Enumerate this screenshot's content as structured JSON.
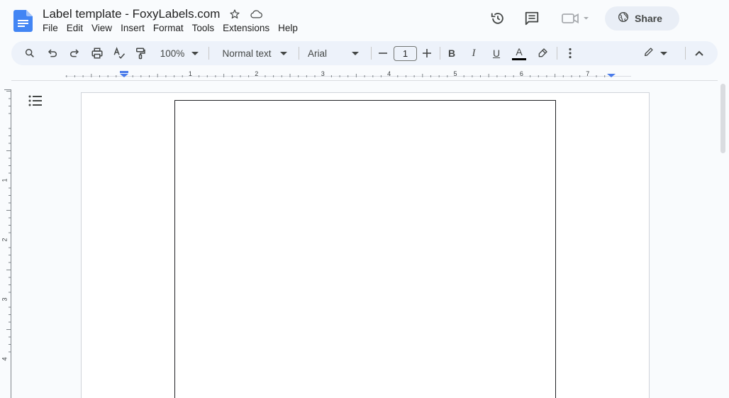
{
  "document": {
    "title": "Label template - FoxyLabels.com"
  },
  "menu": [
    "File",
    "Edit",
    "View",
    "Insert",
    "Format",
    "Tools",
    "Extensions",
    "Help"
  ],
  "header": {
    "share_label": "Share"
  },
  "toolbar": {
    "zoom": "100%",
    "paragraph_style": "Normal text",
    "font_family": "Arial",
    "font_size": "1",
    "bold_label": "B",
    "italic_label": "I",
    "underline_label": "U",
    "text_color_label": "A"
  },
  "ruler": {
    "horizontal_labels": [
      "1",
      "2",
      "3",
      "4",
      "5",
      "6",
      "7"
    ],
    "vertical_labels": [
      "1",
      "2",
      "3",
      "4"
    ]
  },
  "colors": {
    "docs_blue": "#4285f4",
    "indent_marker": "#4a7bea",
    "icon_gray": "#444746"
  }
}
